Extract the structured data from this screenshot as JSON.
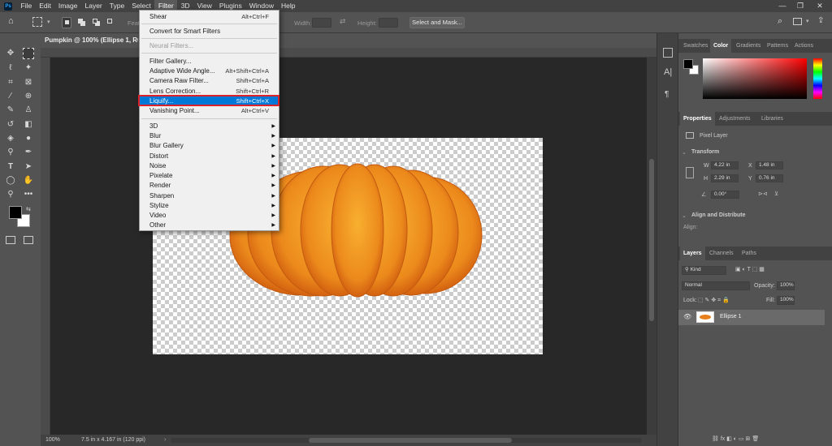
{
  "menubar": {
    "logo": "Ps",
    "items": [
      "File",
      "Edit",
      "Image",
      "Layer",
      "Type",
      "Select",
      "Filter",
      "3D",
      "View",
      "Plugins",
      "Window",
      "Help"
    ],
    "active": "Filter"
  },
  "optbar": {
    "feather_label": "Feat",
    "width_label": "Width:",
    "height_label": "Height:",
    "select_mask": "Select and Mask..."
  },
  "doc": {
    "tab_title": "Pumpkin @ 100% (Ellipse 1, RGB/8)",
    "zoom": "100%",
    "dimensions": "7.5 in x 4.167 in (120 ppi)"
  },
  "filter_menu": {
    "shear": {
      "label": "Shear",
      "shortcut": "Alt+Ctrl+F"
    },
    "convert": "Convert for Smart Filters",
    "neural": "Neural Filters...",
    "gallery": "Filter Gallery...",
    "adaptive": {
      "label": "Adaptive Wide Angle...",
      "shortcut": "Alt+Shift+Ctrl+A"
    },
    "camera_raw": {
      "label": "Camera Raw Filter...",
      "shortcut": "Shift+Ctrl+A"
    },
    "lens": {
      "label": "Lens Correction...",
      "shortcut": "Shift+Ctrl+R"
    },
    "liquify": {
      "label": "Liquify...",
      "shortcut": "Shift+Ctrl+X"
    },
    "vanishing": {
      "label": "Vanishing Point...",
      "shortcut": "Alt+Ctrl+V"
    },
    "submenus": [
      "3D",
      "Blur",
      "Blur Gallery",
      "Distort",
      "Noise",
      "Pixelate",
      "Render",
      "Sharpen",
      "Stylize",
      "Video",
      "Other"
    ]
  },
  "color_panel": {
    "tabs": [
      "Swatches",
      "Color",
      "Gradients",
      "Patterns",
      "Actions"
    ],
    "active": "Color"
  },
  "properties_panel": {
    "tabs": [
      "Properties",
      "Adjustments",
      "Libraries"
    ],
    "layer_type": "Pixel Layer",
    "transform_title": "Transform",
    "w_label": "W",
    "w": "4.22 in",
    "x_label": "X",
    "x": "1.48 in",
    "h_label": "H",
    "h": "2.29 in",
    "y_label": "Y",
    "y": "0.76 in",
    "angle": "0.00°",
    "align_title": "Align and Distribute",
    "align_label": "Align:"
  },
  "layers_panel": {
    "tabs": [
      "Layers",
      "Channels",
      "Paths"
    ],
    "kind": "Kind",
    "blend_mode": "Normal",
    "opacity_label": "Opacity:",
    "opacity": "100%",
    "lock_label": "Lock:",
    "fill_label": "Fill:",
    "fill": "100%",
    "layer_name": "Ellipse 1"
  },
  "colors": {
    "pumpkin_light": "#f5a22a",
    "pumpkin_dark": "#d4540e",
    "highlight": "#0078d7",
    "annotation_red": "#d8232a"
  }
}
